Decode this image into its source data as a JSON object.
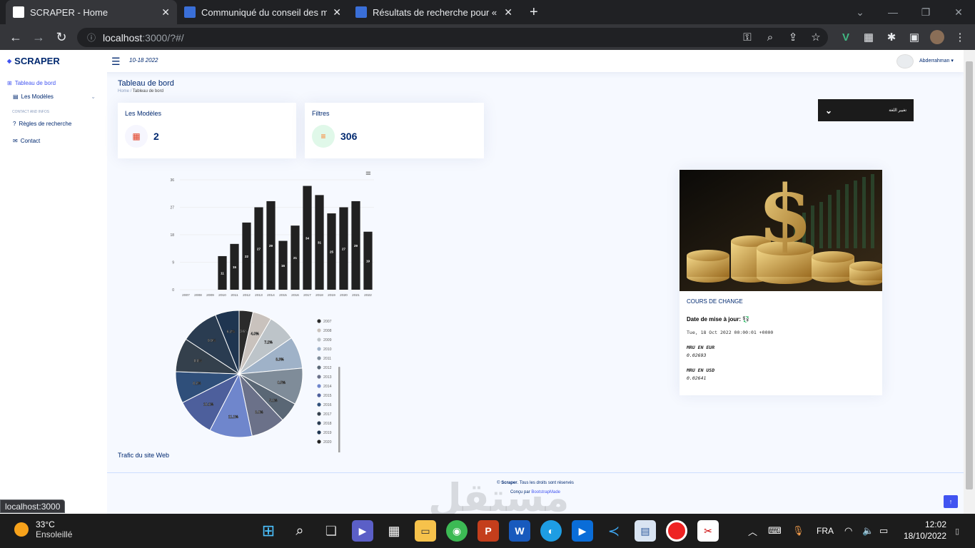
{
  "browser": {
    "tabs": [
      {
        "title": "SCRAPER - Home",
        "active": true
      },
      {
        "title": "Communiqué du conseil des mini",
        "active": false
      },
      {
        "title": "Résultats de recherche pour « go",
        "active": false
      }
    ],
    "new_tab": "+",
    "address": {
      "host": "localhost",
      "path": ":3000/?#/"
    },
    "status_url": "localhost:3000"
  },
  "app": {
    "logo": "SCRAPER",
    "header_date": "10-18 2022",
    "user_name": "Abderrahman",
    "sidebar": {
      "items": [
        {
          "label": "Tableau de bord"
        },
        {
          "label": "Les Modèles"
        }
      ],
      "section_heading": "CONTACT AND INFOS",
      "links": [
        {
          "label": "Règles de recherche"
        },
        {
          "label": "Contact"
        }
      ]
    },
    "page_title": "Tableau de bord",
    "breadcrumb": {
      "home": "Home",
      "current": "Tableau de bord"
    },
    "cards": [
      {
        "title": "Les Modèles",
        "value": "2",
        "icon": "list-icon"
      },
      {
        "title": "Filtres",
        "value": "306",
        "icon": "filter-icon"
      }
    ],
    "language_select": {
      "value": "تغيير اللغة"
    },
    "traffic_title": "Trafic du site Web",
    "exchange": {
      "title": "COURS DE CHANGE",
      "updated_label": "Date de mise à jour:",
      "updated_value": "Tue, 18 Oct 2022 00:00:01 +0000",
      "eur_label": "MRU EN EUR",
      "eur_value": "0.02693",
      "usd_label": "MRU EN USD",
      "usd_value": "0.02641"
    },
    "footer": {
      "copyright_prefix": "©",
      "brand": "Scraper",
      "rights": ". Tous les droits sont réservés",
      "designed_by": "Conçu par",
      "designer": "BootstrapMade"
    },
    "back_to_top": "↑"
  },
  "chart_data": [
    {
      "type": "bar",
      "categories": [
        "2007",
        "2008",
        "2009",
        "2010",
        "2011",
        "2012",
        "2013",
        "2014",
        "2015",
        "2016",
        "2017",
        "2018",
        "2019",
        "2020",
        "2021",
        "2022"
      ],
      "values": [
        0,
        0,
        0,
        11,
        15,
        22,
        27,
        29,
        16,
        21,
        34,
        31,
        25,
        27,
        29,
        19
      ],
      "y_ticks": [
        0,
        9,
        18,
        27,
        36
      ],
      "ylim": [
        0,
        36
      ],
      "color": "#212121",
      "grid": true
    },
    {
      "type": "pie",
      "labels": [
        "2007",
        "2008",
        "2009",
        "2010",
        "2011",
        "2012",
        "2013",
        "2014",
        "2015",
        "2016",
        "2017",
        "2018",
        "2019",
        "2020"
      ],
      "values": [
        3.6,
        4.9,
        7.2,
        8.3,
        9.5,
        5.2,
        8.9,
        11.1,
        10.1,
        8.2,
        8.8,
        9.9,
        6.2,
        0
      ],
      "slice_labels": [
        "3.6%",
        "4.9%",
        "7.2%",
        "8.3%",
        "9.5%",
        "5.2%",
        "8.9%",
        "11.1%",
        "10.1%",
        "8.2%",
        "8.8%",
        "9.9%",
        "6.2%",
        ""
      ],
      "colors": [
        "#2b2b2b",
        "#c9c2bd",
        "#bdc4c9",
        "#9fb2c8",
        "#7f8c99",
        "#5a6775",
        "#6b7189",
        "#6f86cc",
        "#4d5f9c",
        "#2f4f7a",
        "#34404c",
        "#2a3c51",
        "#1f3550",
        "#222"
      ],
      "legend": "right"
    }
  ]
}
